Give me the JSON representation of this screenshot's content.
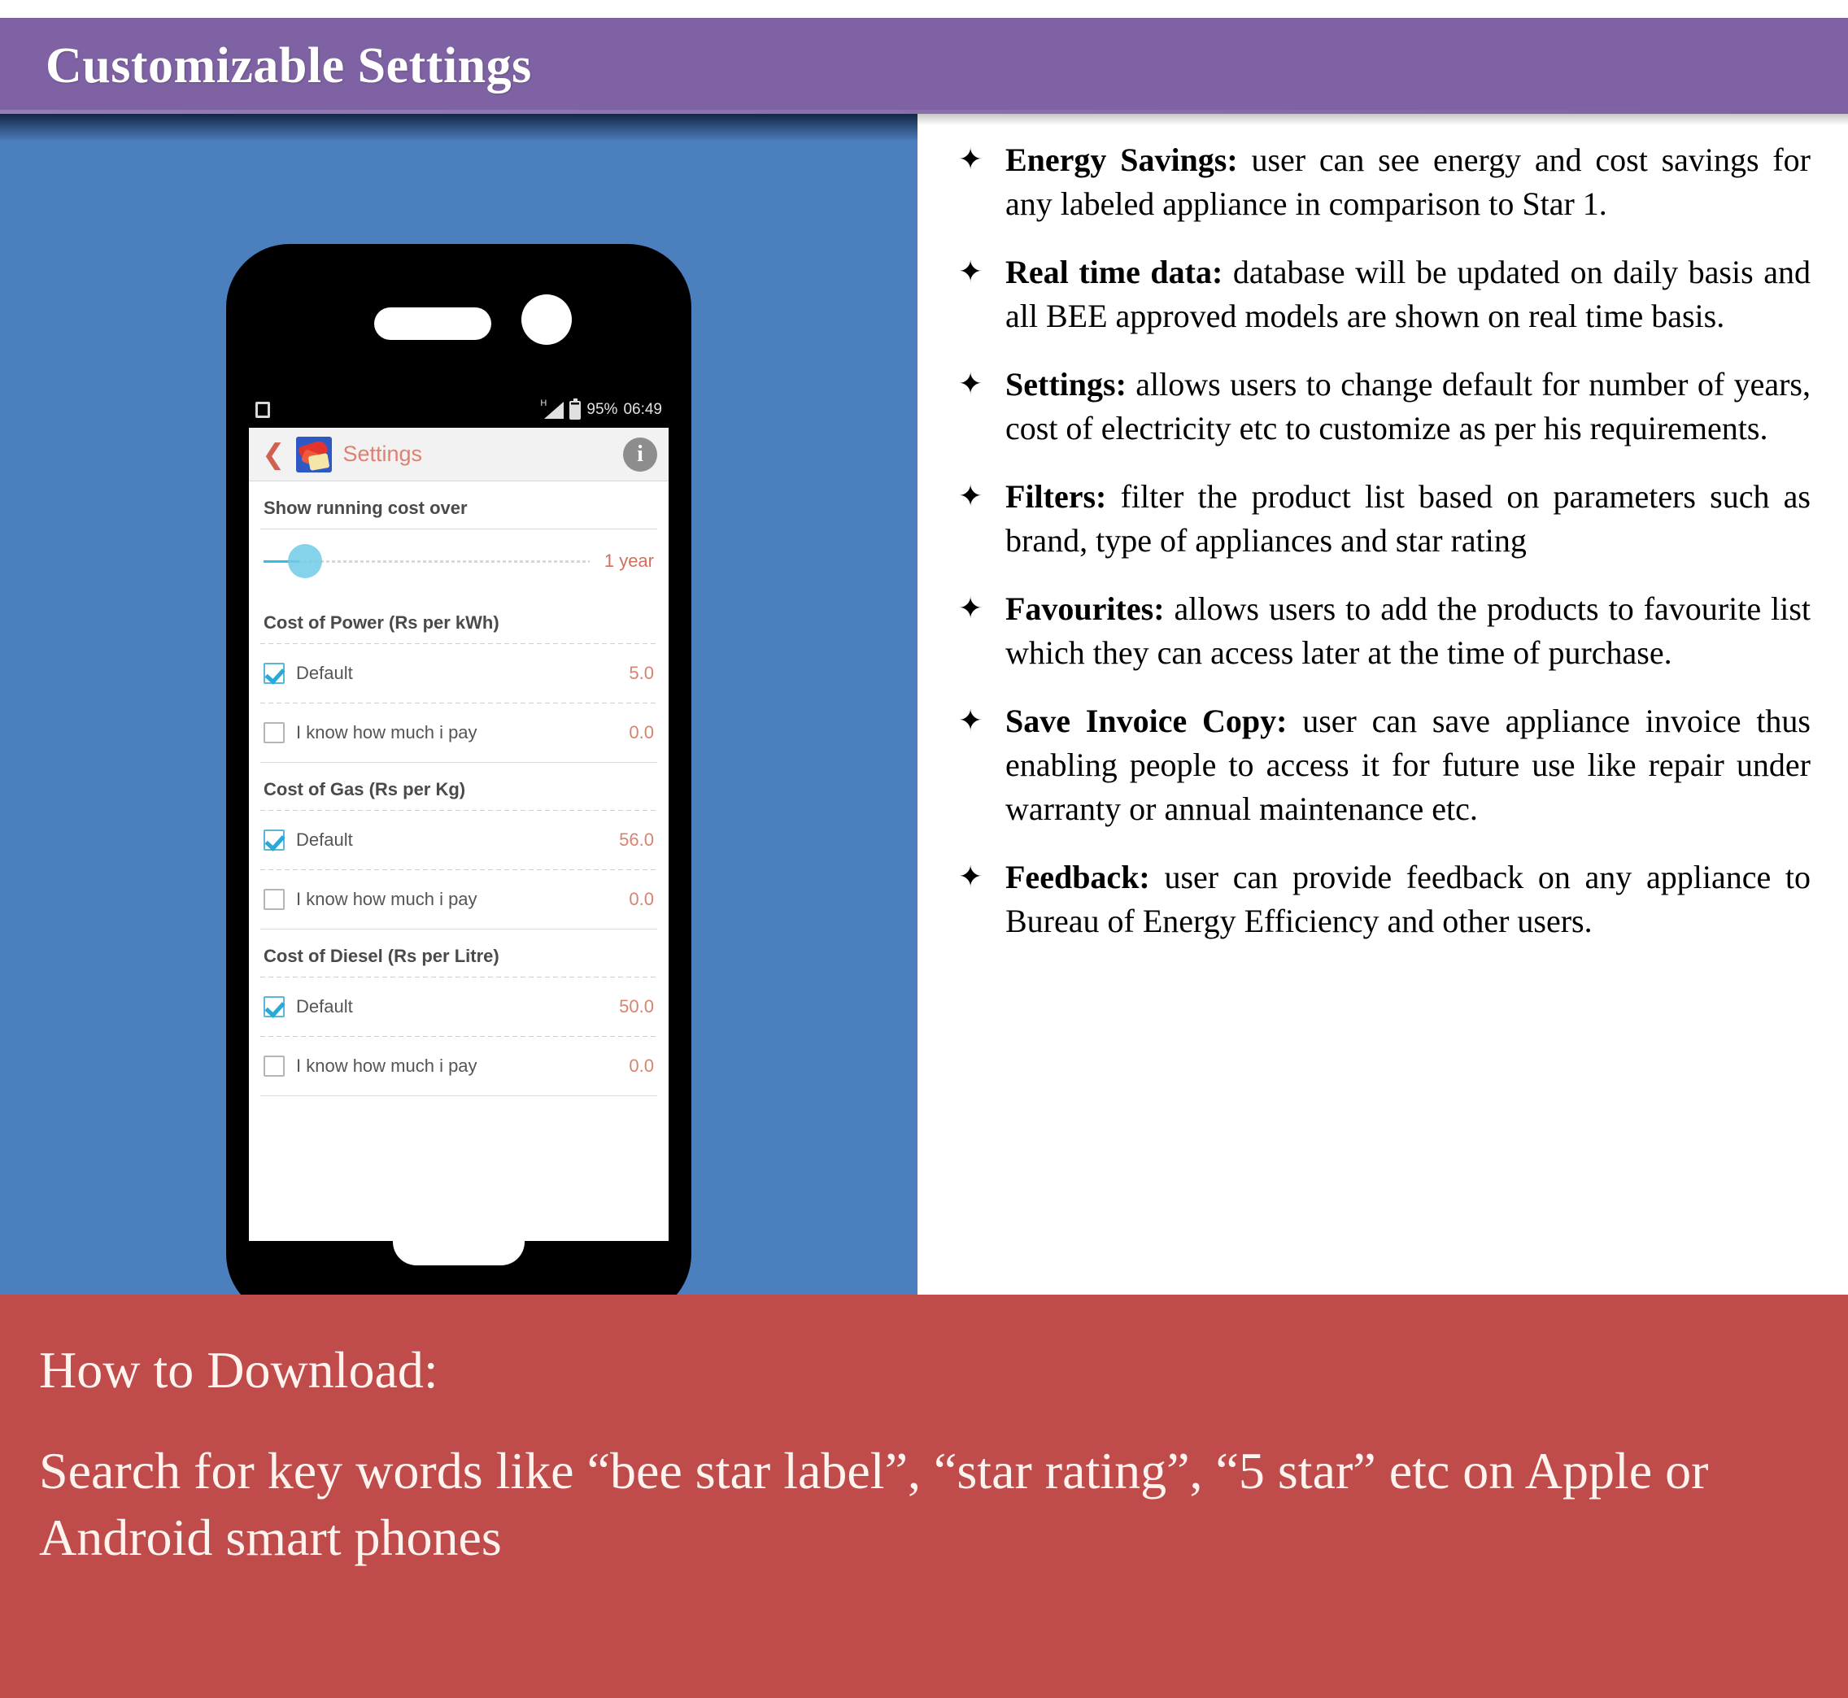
{
  "header": {
    "title": "Customizable Settings"
  },
  "phone": {
    "status_bar": {
      "notification_icon": "square-notification-icon",
      "network_label": "H",
      "signal_icon": "signal-bars-icon",
      "battery_icon": "battery-icon",
      "battery_percent": "95%",
      "clock": "06:49"
    },
    "app_header": {
      "back_icon": "back-chevron-icon",
      "app_icon": "app-logo-icon",
      "title": "Settings",
      "info_icon": "info-icon"
    },
    "sections": [
      {
        "label": "Show running cost over",
        "type": "slider",
        "value": "1 year"
      },
      {
        "label": "Cost of Power (Rs per kWh)",
        "type": "options",
        "options": [
          {
            "label": "Default",
            "value": "5.0",
            "checked": true
          },
          {
            "label": "I know how much i pay",
            "value": "0.0",
            "checked": false
          }
        ]
      },
      {
        "label": "Cost of Gas (Rs per Kg)",
        "type": "options",
        "options": [
          {
            "label": "Default",
            "value": "56.0",
            "checked": true
          },
          {
            "label": "I know how much i pay",
            "value": "0.0",
            "checked": false
          }
        ]
      },
      {
        "label": "Cost of Diesel (Rs per Litre)",
        "type": "options",
        "options": [
          {
            "label": "Default",
            "value": "50.0",
            "checked": true
          },
          {
            "label": "I know how much i pay",
            "value": "0.0",
            "checked": false
          }
        ]
      }
    ]
  },
  "features": {
    "bullet_glyph": "✦",
    "items": [
      {
        "lead": "Energy Savings:",
        "text": " user can see energy and cost savings for any labeled appliance in comparison to Star 1."
      },
      {
        "lead": "Real time data:",
        "text": " database will be updated on daily basis and all BEE approved models are shown on real time basis."
      },
      {
        "lead": "Settings:",
        "text": " allows users to change default for number of years, cost of electricity etc to customize as per his requirements."
      },
      {
        "lead": "Filters:",
        "text": " filter the product list based on parameters such as brand, type of appliances and star rating"
      },
      {
        "lead": "Favourites:",
        "text": " allows users to add the products to favourite list which they can access later at the time of purchase."
      },
      {
        "lead": "Save Invoice Copy:",
        "text": " user can save appliance invoice thus enabling people to access it for future use like repair under warranty or annual maintenance etc."
      },
      {
        "lead": "Feedback:",
        "text": " user can provide feedback on any appliance to Bureau of Energy Efficiency and other users."
      }
    ]
  },
  "footer": {
    "heading": "How to Download:",
    "body": "Search for key words like “bee star label”, “star rating”, “5 star” etc on Apple or Android smart phones"
  },
  "colors": {
    "header_purple": "#7E62A3",
    "panel_blue": "#4C7FBE",
    "footer_red": "#C04B4B",
    "accent_salmon": "#D8836F",
    "slider_cyan": "#35BDE0"
  }
}
